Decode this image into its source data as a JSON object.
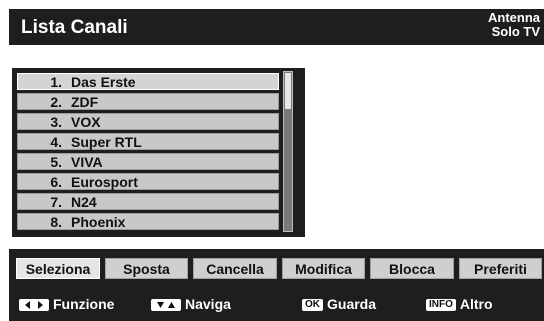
{
  "header": {
    "title": "Lista Canali",
    "source_line1": "Antenna",
    "source_line2": "Solo TV"
  },
  "channels": [
    {
      "num": "1.",
      "name": "Das Erste",
      "selected": true
    },
    {
      "num": "2.",
      "name": "ZDF"
    },
    {
      "num": "3.",
      "name": "VOX"
    },
    {
      "num": "4.",
      "name": "Super RTL"
    },
    {
      "num": "5.",
      "name": "VIVA"
    },
    {
      "num": "6.",
      "name": "Eurosport"
    },
    {
      "num": "7.",
      "name": "N24"
    },
    {
      "num": "8.",
      "name": "Phoenix"
    }
  ],
  "actions": [
    "Seleziona",
    "Sposta",
    "Cancella",
    "Modifica",
    "Blocca",
    "Preferiti"
  ],
  "active_action": "Seleziona",
  "hints": {
    "funzione": "Funzione",
    "naviga": "Naviga",
    "ok_key": "OK",
    "guarda": "Guarda",
    "info_key": "INFO",
    "altro": "Altro"
  },
  "colors": {
    "background": "#1e1e1e",
    "row": "#c8c8c8",
    "text": "#ffffff"
  }
}
